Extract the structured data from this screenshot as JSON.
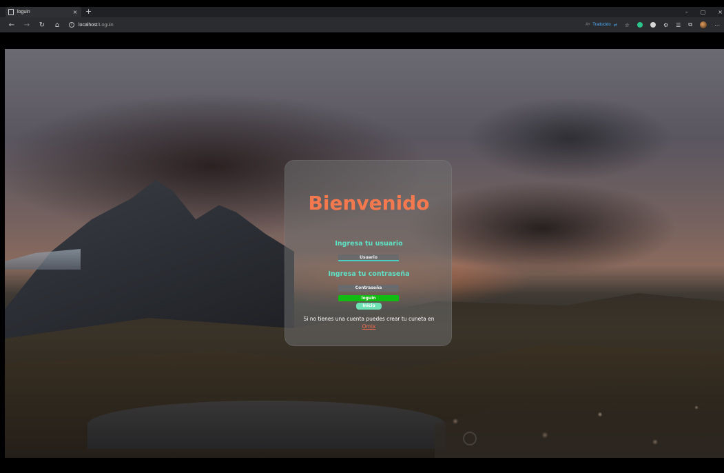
{
  "browser": {
    "tab_title": "loguin",
    "tab_close": "×",
    "new_tab": "+",
    "url_host": "localhost",
    "url_path": "/Loguin",
    "translate_label": "Traducido",
    "nav": {
      "back": "←",
      "forward": "→",
      "refresh": "↻",
      "home": "⌂"
    },
    "win": {
      "minimize": "–",
      "maximize": "▢",
      "close": "×"
    },
    "toolbar_icons": [
      "star-icon",
      "extension-icon",
      "collections-icon",
      "profile-icon"
    ]
  },
  "login": {
    "title": "Bienvenido",
    "user_label": "Ingresa tu usuario",
    "user_placeholder": "Usuario",
    "pass_label": "Ingresa tu contraseña",
    "pass_placeholder": "Contraseña",
    "login_button": "loguin",
    "home_button": "Inicio",
    "signup_text_before": "Si no tienes una cuenta puedes crear tu cuneta en ",
    "signup_link": "Omix"
  },
  "colors": {
    "title": "#f5794f",
    "labels": "#5fe1c6",
    "login_button": "#11bb11",
    "home_button": "#6fe2b4",
    "link": "#f56a4c"
  }
}
